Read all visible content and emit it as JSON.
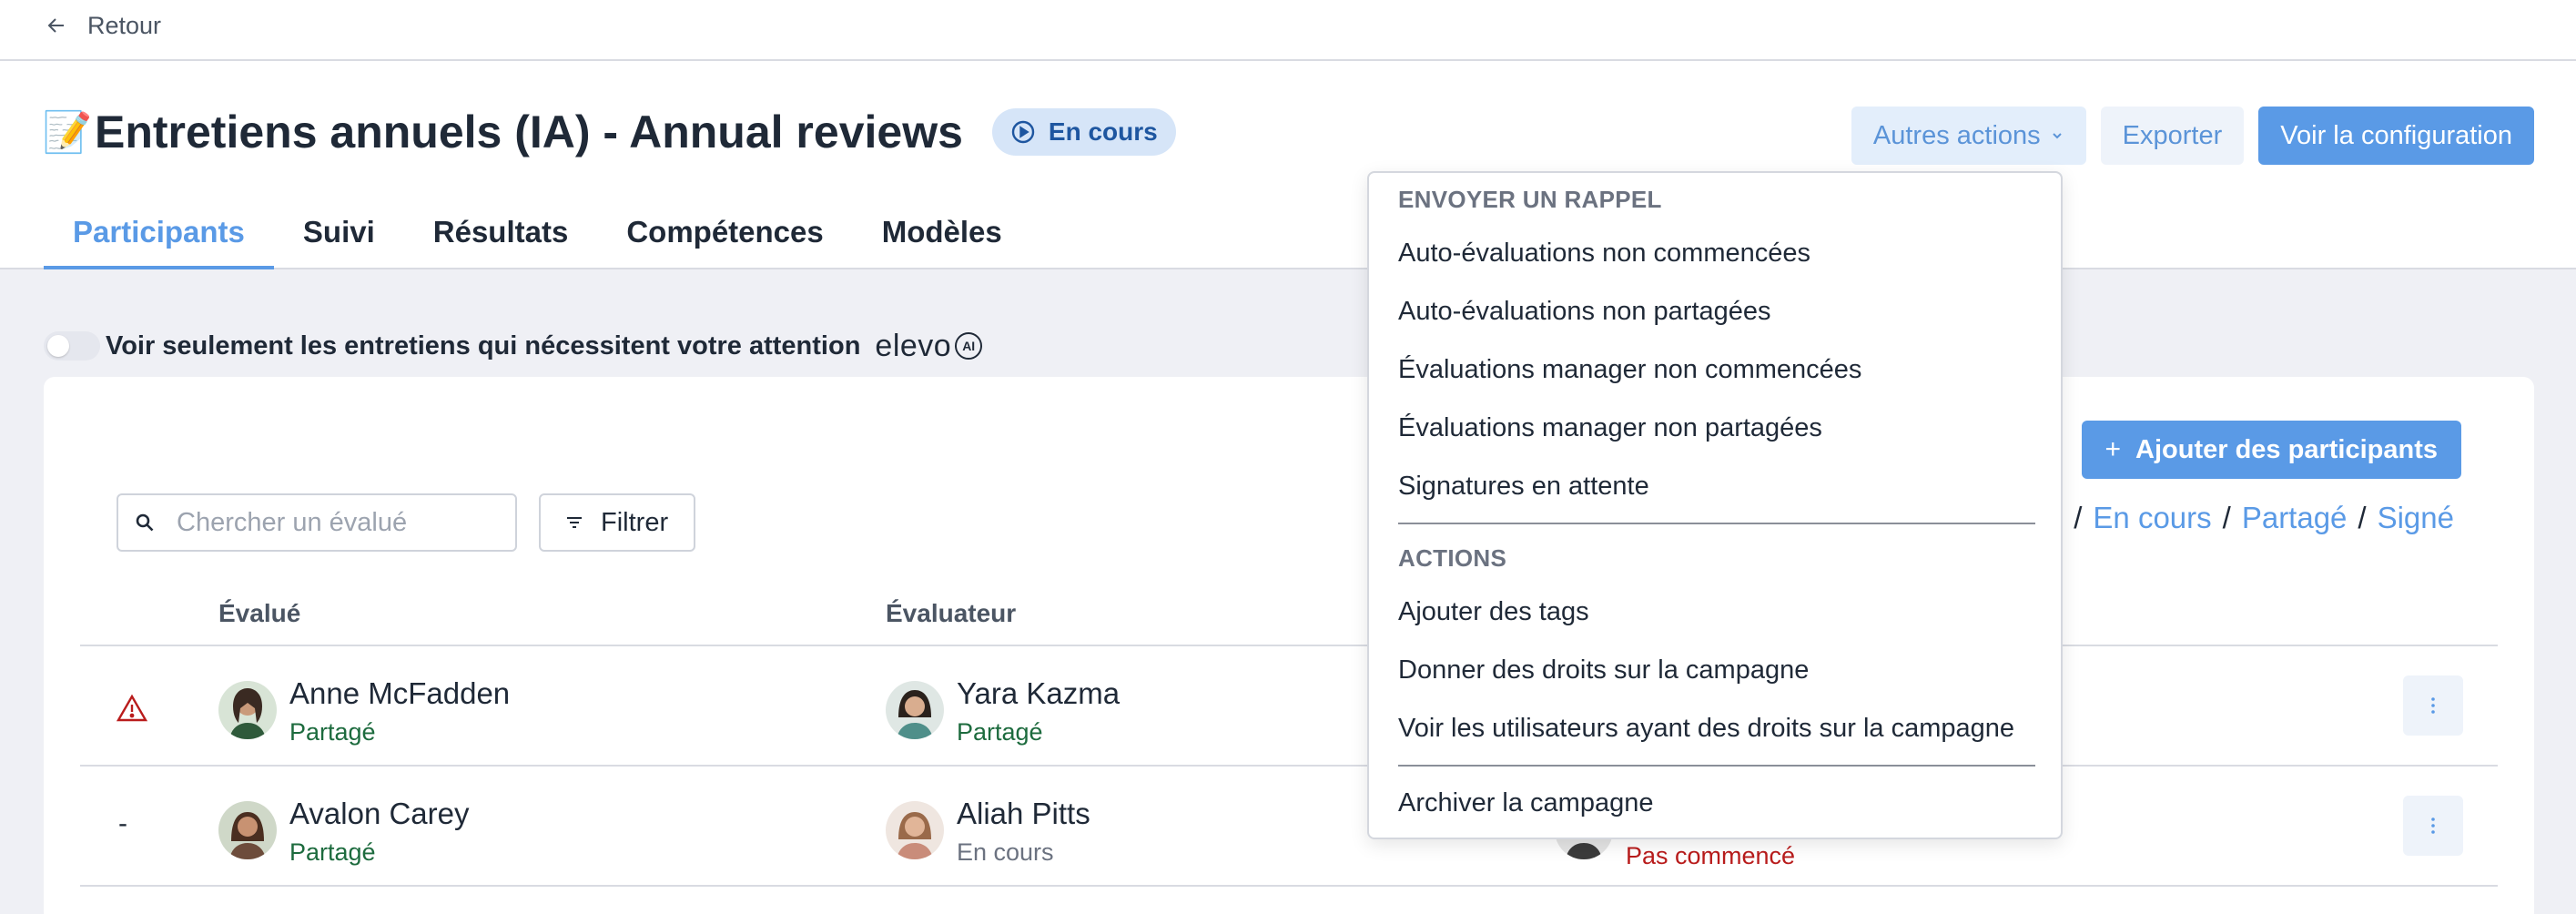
{
  "back": {
    "label": "Retour"
  },
  "header": {
    "emoji": "📝",
    "title": "Entretiens annuels (IA) - Annual reviews",
    "status_badge": "En cours",
    "buttons": {
      "other_actions": "Autres actions",
      "export": "Exporter",
      "view_config": "Voir la configuration"
    },
    "tabs": [
      "Participants",
      "Suivi",
      "Résultats",
      "Compétences",
      "Modèles"
    ]
  },
  "attention_toggle": {
    "label": "Voir seulement les entretiens qui nécessitent votre attention",
    "brand": "elevo",
    "brand_badge": "AI"
  },
  "toolbar": {
    "add_participants": "Ajouter des participants",
    "search_placeholder": "Chercher un évalué",
    "filter": "Filtrer",
    "status_links": [
      "En cours",
      "Partagé",
      "Signé"
    ]
  },
  "table": {
    "columns": {
      "evaluee": "Évalué",
      "evaluator": "Évaluateur"
    },
    "rows": [
      {
        "flag": "warning",
        "evaluee": {
          "name": "Anne McFadden",
          "status": "Partagé"
        },
        "evaluator": {
          "name": "Yara Kazma",
          "status": "Partagé"
        }
      },
      {
        "flag": "-",
        "evaluee": {
          "name": "Avalon Carey",
          "status": "Partagé"
        },
        "evaluator": {
          "name": "Aliah Pitts",
          "status": "En cours"
        },
        "third": {
          "status": "Pas commencé"
        }
      }
    ]
  },
  "dropdown": {
    "section_reminder": "ENVOYER UN RAPPEL",
    "reminder_items": [
      "Auto-évaluations non commencées",
      "Auto-évaluations non partagées",
      "Évaluations manager non commencées",
      "Évaluations manager non partagées",
      "Signatures en attente"
    ],
    "section_actions": "ACTIONS",
    "action_items": [
      "Ajouter des tags",
      "Donner des droits sur la campagne",
      "Voir les utilisateurs ayant des droits sur la campagne"
    ],
    "archive": "Archiver la campagne"
  },
  "colors": {
    "accent": "#5a9ae6",
    "badge_bg": "#d6e5f8",
    "status_green": "#1d6b3e",
    "status_red": "#b91c1c",
    "warning": "#b91c1c"
  }
}
